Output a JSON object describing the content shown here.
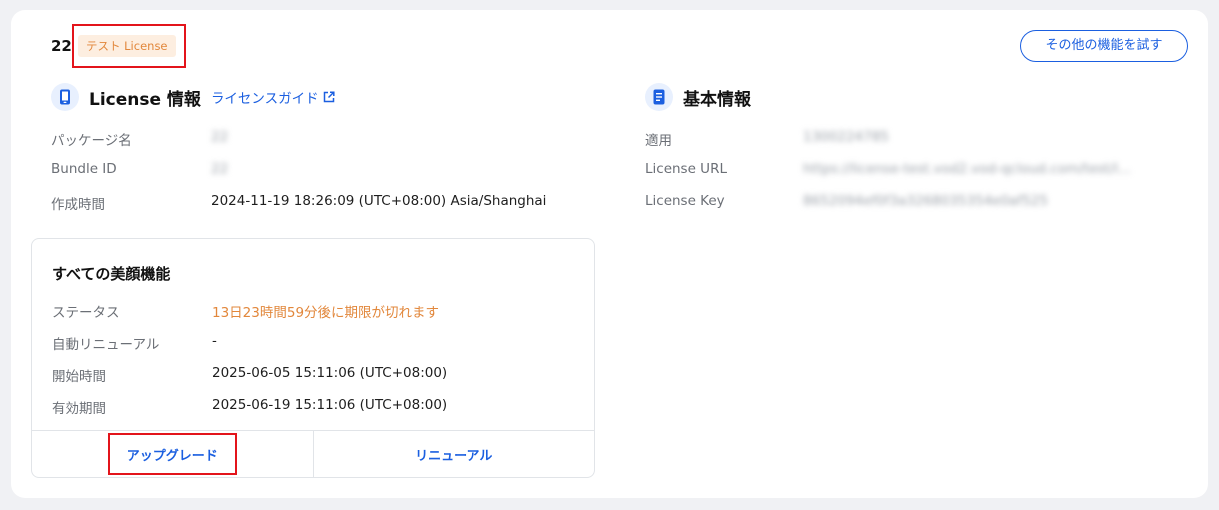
{
  "header": {
    "app_id": "22",
    "tag": "テスト License",
    "try_button": "その他の機能を試す"
  },
  "license_info": {
    "title": "License 情報",
    "guide_link": "ライセンスガイド",
    "rows": [
      {
        "label": "パッケージ名",
        "value": "22"
      },
      {
        "label": "Bundle ID",
        "value": "22"
      },
      {
        "label": "作成時間",
        "value": "2024-11-19 18:26:09 (UTC+08:00) Asia/Shanghai"
      }
    ]
  },
  "basic_info": {
    "title": "基本情報",
    "rows": [
      {
        "label": "適用",
        "value": "1300224785"
      },
      {
        "label": "License URL",
        "value": "https://license-test.vod2.vod-qcloud.com/test/l..."
      },
      {
        "label": "License Key",
        "value": "8652094ef0f3a3268035354e0af525"
      }
    ]
  },
  "beauty": {
    "title": "すべての美顔機能",
    "rows": [
      {
        "label": "ステータス",
        "value": "13日23時間59分後に期限が切れます"
      },
      {
        "label": "自動リニューアル",
        "value": "-"
      },
      {
        "label": "開始時間",
        "value": "2025-06-05 15:11:06 (UTC+08:00)"
      },
      {
        "label": "有効期間",
        "value": "2025-06-19 15:11:06 (UTC+08:00)"
      }
    ],
    "upgrade_button": "アップグレード",
    "renew_button": "リニューアル"
  },
  "colors": {
    "accent": "#1b5fe0",
    "warning": "#e2873b",
    "highlight_box": "#e3141b"
  }
}
